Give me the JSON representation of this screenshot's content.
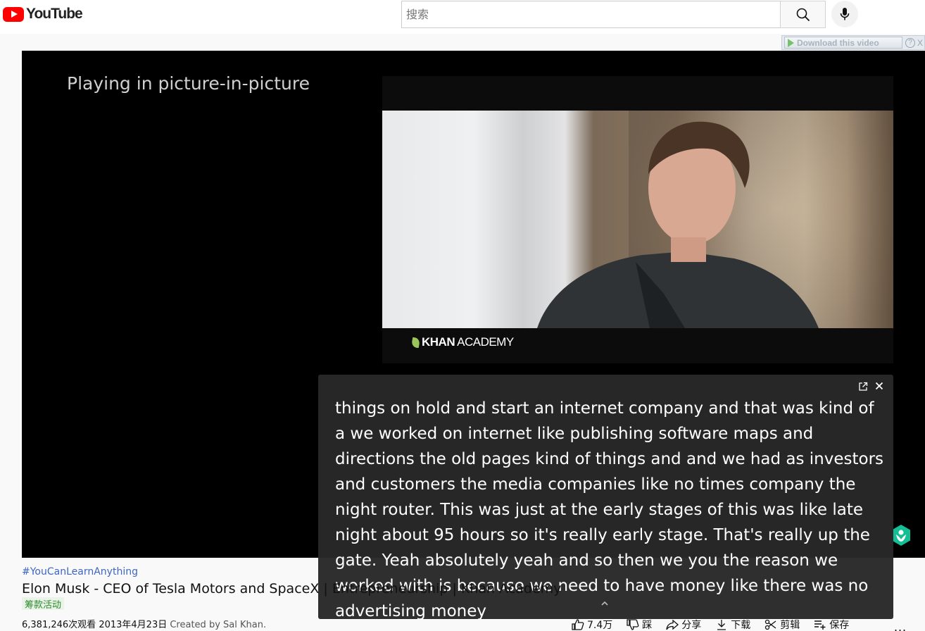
{
  "header": {
    "brand": "YouTube",
    "search_placeholder": "搜索",
    "colors": {
      "brand_red": "#ff0000"
    }
  },
  "extension": {
    "download_label": "Download this video",
    "help_label": "?",
    "close_label": "X"
  },
  "player": {
    "pip_message": "Playing in picture-in-picture",
    "watermark_bold": "KHAN",
    "watermark_light": "ACADEMY"
  },
  "captions": {
    "text": "things on hold and start an internet company and that was kind of a we worked on internet like publishing software maps and directions the old pages kind of things and and we had as investors and customers the media companies like no times company the night router. This was just at the early stages of this was like late night about 95 hours so it's really early stage. That's really up the gate. Yeah absolutely yeah and so then we you the reason we worked with is because we need to have money like there was no advertising money"
  },
  "video": {
    "hashtag": "#YouCanLearnAnything",
    "title": "Elon Musk - CEO of Tesla Motors and SpaceX | Entrepreneurship | Khan Academy",
    "fundraiser_badge": "筹款活动",
    "views": "6,381,246次观看",
    "date": "2013年4月23日",
    "description_start": "Created by Sal Khan."
  },
  "actions": {
    "like_count": "7.4万",
    "dislike_label": "踩",
    "share_label": "分享",
    "download_label": "下载",
    "clip_label": "剪辑",
    "save_label": "保存",
    "more_label": "..."
  }
}
